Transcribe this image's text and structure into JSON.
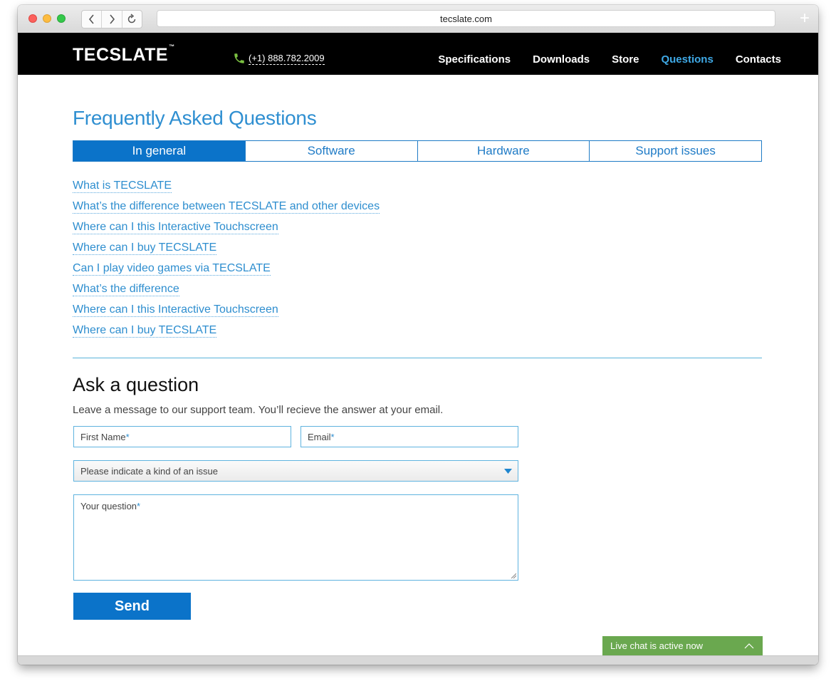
{
  "browser": {
    "url": "tecslate.com",
    "new_tab": "+"
  },
  "header": {
    "logo": "TECSLATE",
    "logo_tm": "™",
    "phone": "(+1) 888.782.2009",
    "nav": [
      {
        "label": "Specifications",
        "active": false
      },
      {
        "label": "Downloads",
        "active": false
      },
      {
        "label": "Store",
        "active": false
      },
      {
        "label": "Questions",
        "active": true
      },
      {
        "label": "Contacts",
        "active": false
      }
    ]
  },
  "faq": {
    "title": "Frequently Asked Questions",
    "tabs": [
      {
        "label": "In general",
        "active": true
      },
      {
        "label": "Software",
        "active": false
      },
      {
        "label": "Hardware",
        "active": false
      },
      {
        "label": "Support issues",
        "active": false
      }
    ],
    "questions": [
      "What is TECSLATE",
      "What’s the difference between TECSLATE and other devices",
      "Where can I this Interactive Touchscreen",
      "Where can I buy TECSLATE",
      "Can I play video games via TECSLATE",
      "What’s the difference",
      "Where can I this Interactive Touchscreen",
      "Where can I buy TECSLATE"
    ]
  },
  "ask": {
    "title": "Ask a question",
    "description": "Leave a message to our support team. You’ll recieve the answer at your email.",
    "first_name_label": "First Name",
    "email_label": "Email",
    "required_mark": "*",
    "issue_select": "Please indicate a kind of an issue",
    "question_label": "Your question",
    "send_label": "Send"
  },
  "live_chat": {
    "label": "Live chat is active now"
  },
  "colors": {
    "accent": "#0b73c9",
    "link": "#2e8ecf",
    "nav_active": "#3fa9e6",
    "chat_green": "#6aa84f"
  }
}
